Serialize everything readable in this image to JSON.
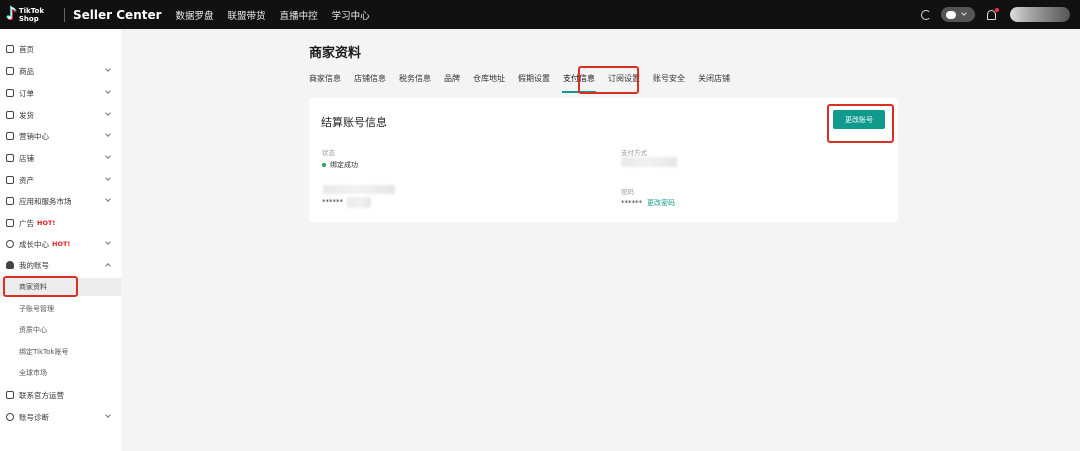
{
  "topbar": {
    "logo_line1": "TikTok",
    "logo_line2": "Shop",
    "brand": "Seller Center",
    "nav": [
      "数据罗盘",
      "联盟带货",
      "直播中控",
      "学习中心"
    ]
  },
  "sidebar": {
    "items": [
      {
        "label": "首页",
        "icon": "home-icon"
      },
      {
        "label": "商品",
        "icon": "product-icon"
      },
      {
        "label": "订单",
        "icon": "order-icon"
      },
      {
        "label": "发货",
        "icon": "shipping-icon"
      },
      {
        "label": "营销中心",
        "icon": "marketing-icon"
      },
      {
        "label": "店铺",
        "icon": "store-icon"
      },
      {
        "label": "资产",
        "icon": "wallet-icon"
      },
      {
        "label": "应用和服务市场",
        "icon": "apps-icon"
      },
      {
        "label": "广告",
        "icon": "ad-icon",
        "badge": "HOT!"
      },
      {
        "label": "成长中心",
        "icon": "growth-icon",
        "badge": "HOT!"
      },
      {
        "label": "我的账号",
        "icon": "user-icon"
      }
    ],
    "sub_items": [
      "商家资料",
      "子账号管理",
      "资质中心",
      "绑定TikTok账号",
      "全球市场"
    ],
    "bottom_items": [
      {
        "label": "联系官方运营",
        "icon": "contact-icon"
      },
      {
        "label": "账号诊断",
        "icon": "diagnosis-icon"
      }
    ]
  },
  "main": {
    "title": "商家资料",
    "tabs": [
      "商家信息",
      "店铺信息",
      "税务信息",
      "品牌",
      "仓库地址",
      "假期设置",
      "支付信息",
      "订阅设置",
      "账号安全",
      "关闭店铺"
    ],
    "active_tab": "支付信息",
    "card": {
      "title": "结算账号信息",
      "change_button": "更改账号",
      "status_label": "状态",
      "status_value": "绑定成功",
      "payment_method_label": "支付方式",
      "account_masked": "******",
      "password_label": "密码",
      "password_masked": "******",
      "change_password_link": "更改密码"
    }
  },
  "colors": {
    "accent": "#109a8c",
    "highlight": "#d93025",
    "topbar": "#111111",
    "hot": "#e02020"
  }
}
